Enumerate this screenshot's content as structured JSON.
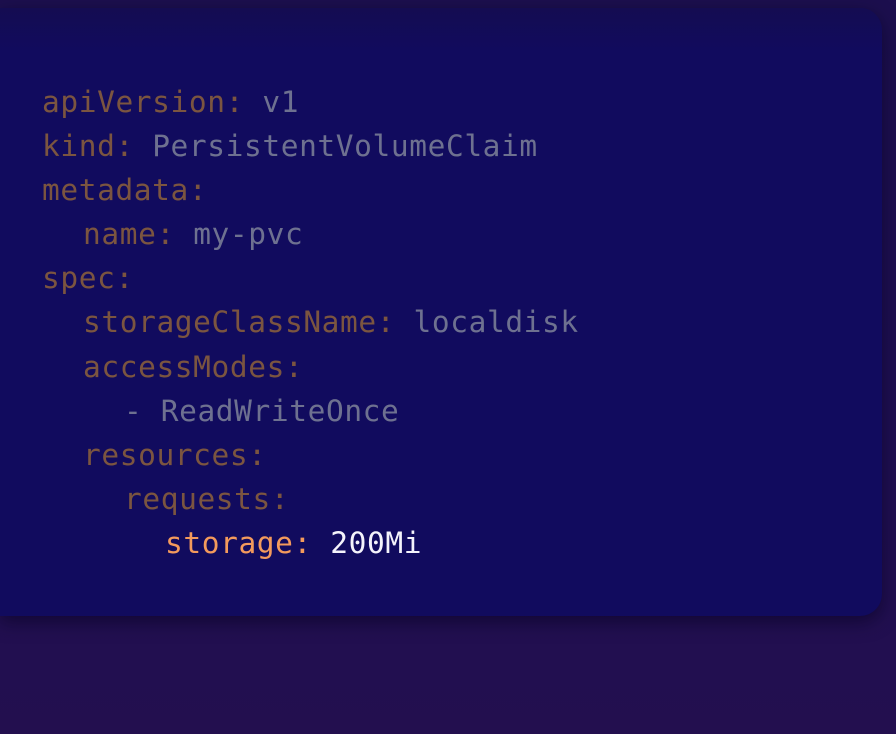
{
  "code": {
    "lines": [
      {
        "key": "apiVersion",
        "value": "v1"
      },
      {
        "key": "kind",
        "value": "PersistentVolumeClaim"
      },
      {
        "key": "metadata",
        "value": ""
      },
      {
        "key": "name",
        "value": "my-pvc"
      },
      {
        "key": "spec",
        "value": ""
      },
      {
        "key": "storageClassName",
        "value": "localdisk"
      },
      {
        "key": "accessModes",
        "value": ""
      },
      {
        "key": "",
        "value": "- ReadWriteOnce"
      },
      {
        "key": "resources",
        "value": ""
      },
      {
        "key": "requests",
        "value": ""
      },
      {
        "key": "storage",
        "value": "200Mi"
      }
    ],
    "highlighted_line": "storage",
    "colors": {
      "panel_background": "#110b5e",
      "page_background": "#1f0f52",
      "key_dim": "#7b5540",
      "value_dim": "#6e7190",
      "key_highlight": "#f39a5c",
      "value_highlight": "#f4f3fb"
    }
  }
}
